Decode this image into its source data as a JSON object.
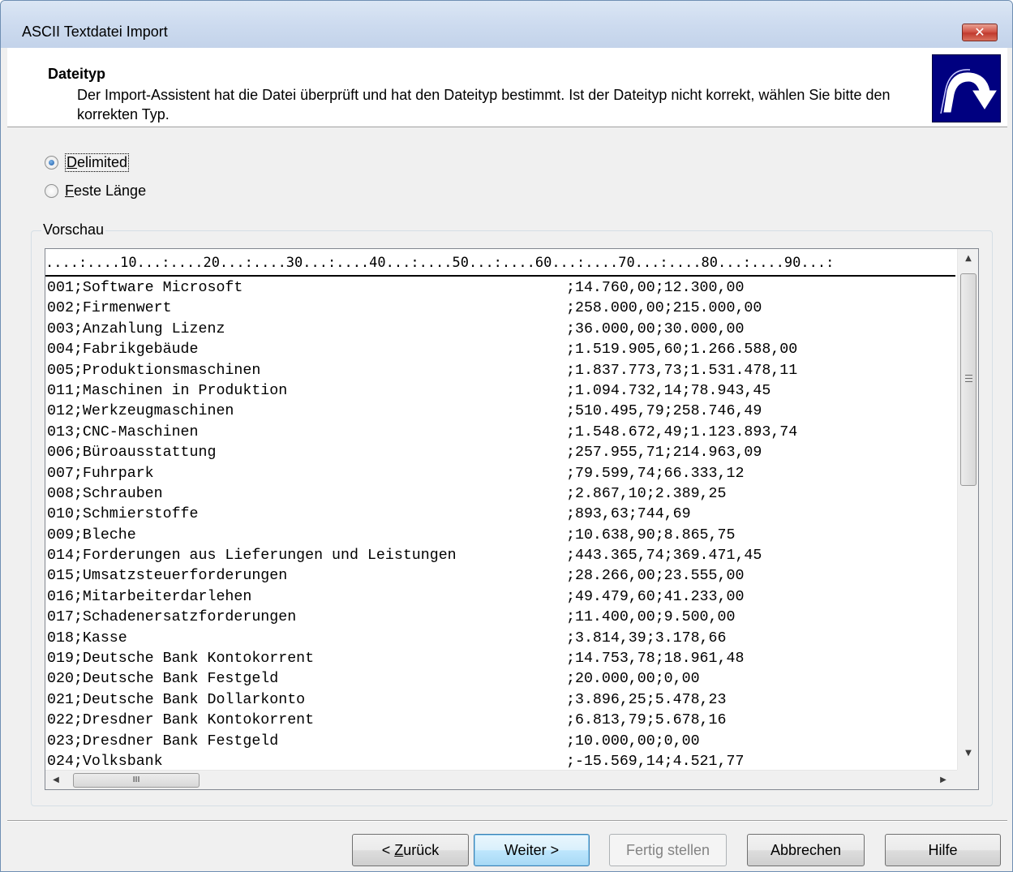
{
  "window": {
    "title": "ASCII Textdatei Import",
    "close_glyph": "✕"
  },
  "header": {
    "title": "Dateityp",
    "description": "Der Import-Assistent hat die Datei überprüft und hat den Dateityp bestimmt. Ist der Dateityp nicht korrekt, wählen Sie bitte den korrekten Typ.",
    "icon": "wizard-arrow-icon"
  },
  "options": {
    "delimited": {
      "accesskey": "D",
      "rest": "elimited",
      "selected": true
    },
    "fixed": {
      "accesskey": "F",
      "rest": "este Länge",
      "selected": false
    }
  },
  "preview": {
    "label": "Vorschau",
    "ruler": "....:....10...:....20...:....30...:....40...:....50...:....60...:....70...:....80...:....90...:",
    "rows": [
      {
        "left": "001;Software Microsoft",
        "right": ";14.760,00;12.300,00"
      },
      {
        "left": "002;Firmenwert",
        "right": ";258.000,00;215.000,00"
      },
      {
        "left": "003;Anzahlung Lizenz",
        "right": ";36.000,00;30.000,00"
      },
      {
        "left": "004;Fabrikgebäude",
        "right": ";1.519.905,60;1.266.588,00"
      },
      {
        "left": "005;Produktionsmaschinen",
        "right": ";1.837.773,73;1.531.478,11"
      },
      {
        "left": "011;Maschinen in Produktion",
        "right": ";1.094.732,14;78.943,45"
      },
      {
        "left": "012;Werkzeugmaschinen",
        "right": ";510.495,79;258.746,49"
      },
      {
        "left": "013;CNC-Maschinen",
        "right": ";1.548.672,49;1.123.893,74"
      },
      {
        "left": "006;Büroausstattung",
        "right": ";257.955,71;214.963,09"
      },
      {
        "left": "007;Fuhrpark",
        "right": ";79.599,74;66.333,12"
      },
      {
        "left": "008;Schrauben",
        "right": ";2.867,10;2.389,25"
      },
      {
        "left": "010;Schmierstoffe",
        "right": ";893,63;744,69"
      },
      {
        "left": "009;Bleche",
        "right": ";10.638,90;8.865,75"
      },
      {
        "left": "014;Forderungen aus Lieferungen und Leistungen",
        "right": ";443.365,74;369.471,45"
      },
      {
        "left": "015;Umsatzsteuerforderungen",
        "right": ";28.266,00;23.555,00"
      },
      {
        "left": "016;Mitarbeiterdarlehen",
        "right": ";49.479,60;41.233,00"
      },
      {
        "left": "017;Schadenersatzforderungen",
        "right": ";11.400,00;9.500,00"
      },
      {
        "left": "018;Kasse",
        "right": ";3.814,39;3.178,66"
      },
      {
        "left": "019;Deutsche Bank Kontokorrent",
        "right": ";14.753,78;18.961,48"
      },
      {
        "left": "020;Deutsche Bank Festgeld",
        "right": ";20.000,00;0,00"
      },
      {
        "left": "021;Deutsche Bank Dollarkonto",
        "right": ";3.896,25;5.478,23"
      },
      {
        "left": "022;Dresdner Bank Kontokorrent",
        "right": ";6.813,79;5.678,16"
      },
      {
        "left": "023;Dresdner Bank Festgeld",
        "right": ";10.000,00;0,00"
      },
      {
        "left": "024;Volksbank",
        "right": ";-15.569,14;4.521,77"
      }
    ],
    "scroll": {
      "up": "▲",
      "down": "▼",
      "left": "◀",
      "right": "▶",
      "hgrip": "III"
    }
  },
  "buttons": {
    "back": {
      "prefix": "< ",
      "accesskey": "Z",
      "rest": "urück"
    },
    "next": {
      "label": "Weiter >"
    },
    "finish": {
      "label": "Fertig stellen",
      "enabled": false
    },
    "cancel": {
      "label": "Abbrechen"
    },
    "help": {
      "label": "Hilfe"
    }
  }
}
